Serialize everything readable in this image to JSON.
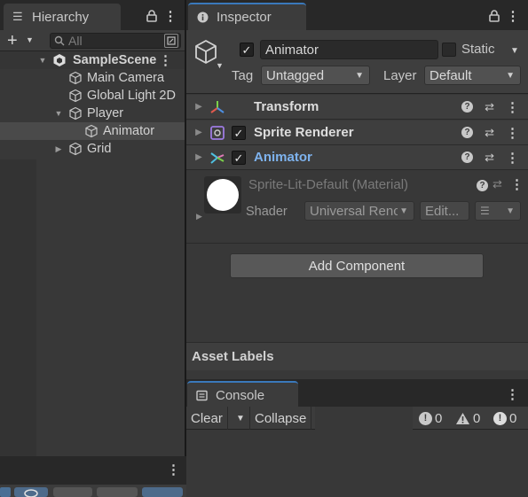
{
  "hierarchy": {
    "tab_label": "Hierarchy",
    "add_label": "+",
    "search_placeholder": "All",
    "tree": [
      {
        "label": "SampleScene",
        "kind": "scene"
      },
      {
        "label": "Main Camera"
      },
      {
        "label": "Global Light 2D"
      },
      {
        "label": "Player"
      },
      {
        "label": "Animator",
        "selected": true
      },
      {
        "label": "Grid"
      }
    ]
  },
  "inspector": {
    "tab_label": "Inspector",
    "object_name": "Animator",
    "static_label": "Static",
    "tag_label": "Tag",
    "tag_value": "Untagged",
    "layer_label": "Layer",
    "layer_value": "Default",
    "components": [
      {
        "name": "Transform",
        "icon": "transform-icon",
        "color": "#dddddd"
      },
      {
        "name": "Sprite Renderer",
        "icon": "sprite-renderer-icon",
        "color": "#dddddd"
      },
      {
        "name": "Animator",
        "icon": "animator-icon",
        "color": "#7eb3ee"
      }
    ],
    "material": {
      "name": "Sprite-Lit-Default (Material)",
      "shader_label": "Shader",
      "shader_value": "Universal Renc",
      "edit_label": "Edit..."
    },
    "add_component_label": "Add Component",
    "asset_labels": "Asset Labels"
  },
  "console": {
    "tab_label": "Console",
    "clear_label": "Clear",
    "collapse_label": "Collapse",
    "info_count": "0",
    "warning_count": "0",
    "error_count": "0"
  },
  "colors": {
    "accent": "#3a79bb",
    "animator_name": "#7eb3ee",
    "panel": "#383838",
    "header": "#282828"
  }
}
